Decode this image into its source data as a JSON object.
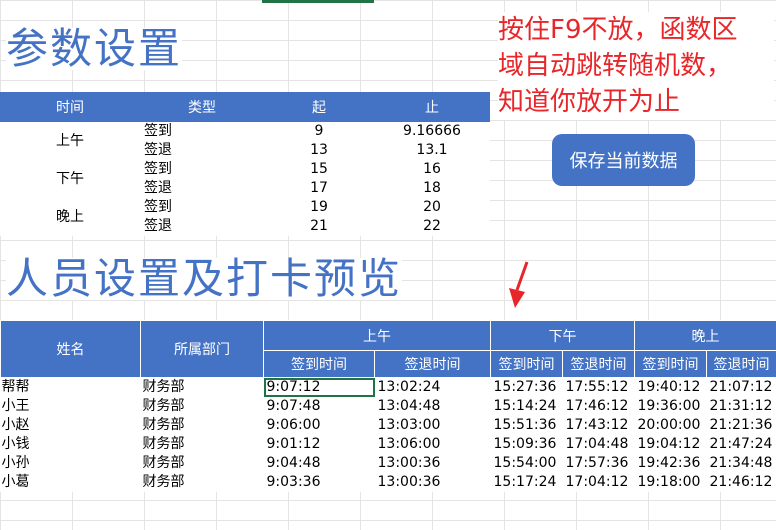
{
  "titles": {
    "params": "参数设置",
    "personnel": "人员设置及打卡预览"
  },
  "note": {
    "line1": "按住F9不放，函数区",
    "line2": "域自动跳转随机数，",
    "line3": "知道你放开为止"
  },
  "save_button": "保存当前数据",
  "params_table": {
    "headers": [
      "时间",
      "类型",
      "起",
      "止"
    ],
    "rows": [
      {
        "period": "上午",
        "type": "签到",
        "start": "9",
        "end": "9.16666"
      },
      {
        "period": "",
        "type": "签退",
        "start": "13",
        "end": "13.1"
      },
      {
        "period": "下午",
        "type": "签到",
        "start": "15",
        "end": "16"
      },
      {
        "period": "",
        "type": "签退",
        "start": "17",
        "end": "18"
      },
      {
        "period": "晚上",
        "type": "签到",
        "start": "19",
        "end": "20"
      },
      {
        "period": "",
        "type": "签退",
        "start": "21",
        "end": "22"
      }
    ]
  },
  "staff_table": {
    "col_name": "姓名",
    "col_dept": "所属部门",
    "groups": [
      "上午",
      "下午",
      "晚上"
    ],
    "sub_in": "签到时间",
    "sub_out": "签退时间",
    "rows": [
      {
        "name": "帮帮",
        "dept": "财务部",
        "times": [
          "9:07:12",
          "13:02:24",
          "15:27:36",
          "17:55:12",
          "19:40:12",
          "21:07:12"
        ]
      },
      {
        "name": "小王",
        "dept": "财务部",
        "times": [
          "9:07:48",
          "13:04:48",
          "15:14:24",
          "17:46:12",
          "19:36:00",
          "21:31:12"
        ]
      },
      {
        "name": "小赵",
        "dept": "财务部",
        "times": [
          "9:06:00",
          "13:03:00",
          "15:51:36",
          "17:43:12",
          "20:00:00",
          "21:21:36"
        ]
      },
      {
        "name": "小钱",
        "dept": "财务部",
        "times": [
          "9:01:12",
          "13:06:00",
          "15:09:36",
          "17:04:48",
          "19:04:12",
          "21:47:24"
        ]
      },
      {
        "name": "小孙",
        "dept": "财务部",
        "times": [
          "9:04:48",
          "13:00:36",
          "15:54:00",
          "17:57:36",
          "19:42:36",
          "21:34:48"
        ]
      },
      {
        "name": "小葛",
        "dept": "财务部",
        "times": [
          "9:03:36",
          "13:00:36",
          "15:17:24",
          "17:04:12",
          "19:18:00",
          "21:46:12"
        ]
      }
    ]
  },
  "colors": {
    "accent": "#4472c4",
    "note": "#e8262a",
    "selection": "#217346"
  }
}
